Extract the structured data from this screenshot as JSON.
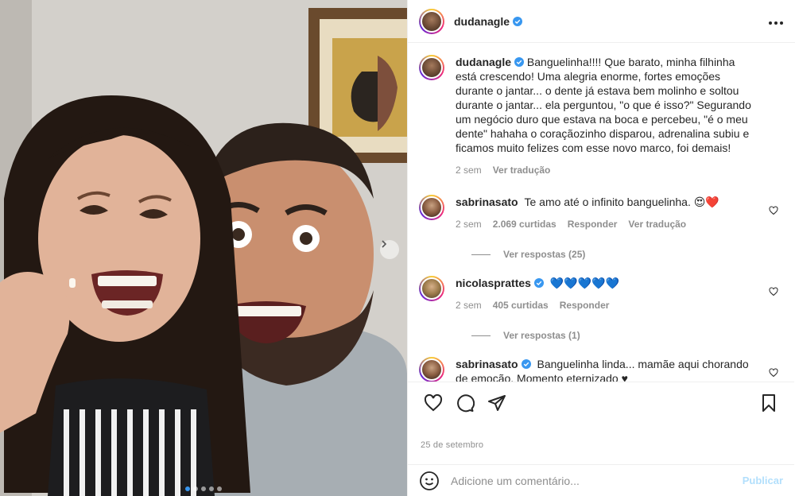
{
  "post": {
    "author": "dudanagle",
    "caption": "Banguelinha!!!! Que barato, minha filhinha está crescendo! Uma alegria enorme, fortes emoções durante o jantar... o dente já estava bem molinho e soltou durante o jantar... ela perguntou, \"o que é isso?\" Segurando um negócio duro que estava na boca e percebeu, \"é o meu dente\" hahaha o coraçãozinho disparou, adrenalina subiu e ficamos muito felizes com esse novo marco, foi demais!",
    "caption_time": "2 sem",
    "see_translation": "Ver tradução",
    "date": "25 de setembro",
    "carousel_dots": 5,
    "active_dot": 0
  },
  "comments": [
    {
      "user": "sabrinasato",
      "verified": false,
      "text": "Te amo até o infinito banguelinha. 😍❤️",
      "time": "2 sem",
      "likes": "2.069 curtidas",
      "reply": "Responder",
      "translate": "Ver tradução",
      "view_replies": "Ver respostas (25)"
    },
    {
      "user": "nicolasprattes",
      "verified": true,
      "text": "💙💙💙💙💙",
      "time": "2 sem",
      "likes": "405 curtidas",
      "reply": "Responder",
      "view_replies": "Ver respostas (1)"
    },
    {
      "user": "sabrinasato",
      "verified": true,
      "text": "Banguelinha linda... mamãe aqui chorando de emoção. Momento eternizado ♥"
    }
  ],
  "composer": {
    "placeholder": "Adicione um comentário...",
    "publish": "Publicar"
  },
  "icons": {
    "more": "more-options-icon",
    "like": "heart-icon",
    "comment": "comment-icon",
    "share": "paper-plane-icon",
    "save": "bookmark-icon",
    "emoji": "smiley-icon",
    "next": "chevron-right-icon"
  },
  "colors": {
    "verified": "#3897f0",
    "muted": "#8e8e8e",
    "publish_disabled": "#b2dffc"
  }
}
